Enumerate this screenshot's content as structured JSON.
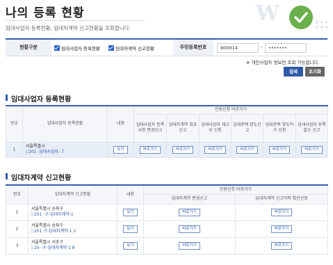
{
  "header": {
    "title": "나의 등록 현황",
    "description": "임대사업자 등록현황, 임대차계약 신고현황을 조회합니다."
  },
  "search": {
    "status_label": "현황구분",
    "check1_label": "임대사업자 등록현황",
    "check2_label": "임대차계약 신고현황",
    "id_label": "주민등록번호",
    "id_front_value": "800914",
    "id_dash": "-",
    "id_back_value": "•••••••",
    "notice": "※ 개인사업자 정보만 조회 가능합니다.",
    "search_button": "검색",
    "reset_button": "초기화"
  },
  "section1": {
    "title": "임대사업자 등록현황",
    "headers": {
      "no": "번호",
      "status": "임대사업자 등록현황",
      "content": "내용",
      "group": "민원신청 바로가기",
      "sub": [
        "임대사업자 등록사항 변경신고",
        "임대차계약 최초신고",
        "임대사업자 재고부 신청",
        "임대주택 양도신고",
        "임대주택 양도허가 신청",
        "임대사업자 등록말소 신고"
      ]
    },
    "rows": [
      {
        "no": "1",
        "addr1": "서울특별시",
        "addr2": "| 201         -임대사업자-        7",
        "view": "보기",
        "go": "바로가기"
      }
    ]
  },
  "section2": {
    "title": "임대차계약 신고현황",
    "headers": {
      "no": "번호",
      "status": "임대차계약 신고현황",
      "content": "내용",
      "group": "민원신청 바로가기",
      "sub": [
        "임대차계약 변경신고",
        "임대차계약 신고이력 확인신청"
      ]
    },
    "rows": [
      {
        "no": "1",
        "addr1": "서울특별시 송파구",
        "addr2": "| 201         -구-임대차계약-1·",
        "view": "보기",
        "go": "바로가기"
      },
      {
        "no": "2",
        "addr1": "서울특별시 송파구",
        "addr2": "| 201         구-임대차계약-1      2",
        "view": "보기",
        "go": "바로가기"
      },
      {
        "no": "3",
        "addr1": "서울특별시 서초구",
        "addr2": "| 20          -구-임대차계약-1      8",
        "view": "보기",
        "go": "바로가기"
      }
    ]
  }
}
